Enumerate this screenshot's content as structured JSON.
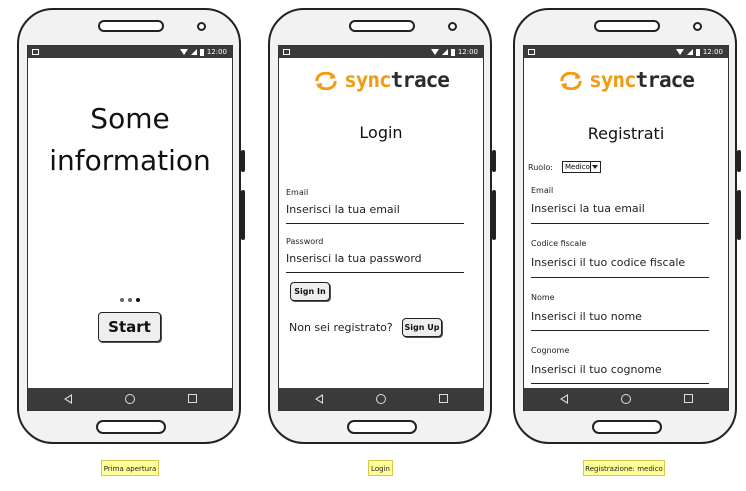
{
  "status_time": "12:00",
  "screen1": {
    "headline": "Some information",
    "start_label": "Start",
    "caption": "Prima apertura"
  },
  "screen2": {
    "logo_part1": "sync",
    "logo_part2": "trace",
    "title": "Login",
    "email_label": "Email",
    "email_placeholder": "Inserisci la tua email",
    "password_label": "Password",
    "password_placeholder": "Inserisci la tua password",
    "signin_label": "Sign In",
    "not_registered": "Non sei registrato?",
    "signup_label": "Sign Up",
    "caption": "Login"
  },
  "screen3": {
    "logo_part1": "sync",
    "logo_part2": "trace",
    "title": "Registrati",
    "role_label": "Ruolo:",
    "role_value": "Medico",
    "email_label": "Email",
    "email_placeholder": "Inserisci la tua email",
    "cf_label": "Codice fiscale",
    "cf_placeholder": "Inserisci il tuo codice fiscale",
    "name_label": "Nome",
    "name_placeholder": "Inserisci il tuo nome",
    "surname_label": "Cognome",
    "surname_placeholder": "Inserisci il tuo cognome",
    "caption": "Registrazione: medico"
  },
  "colors": {
    "logo_orange": "#f39c12",
    "bar_dark": "#3a3a3a",
    "caption_bg": "#ffff99"
  }
}
